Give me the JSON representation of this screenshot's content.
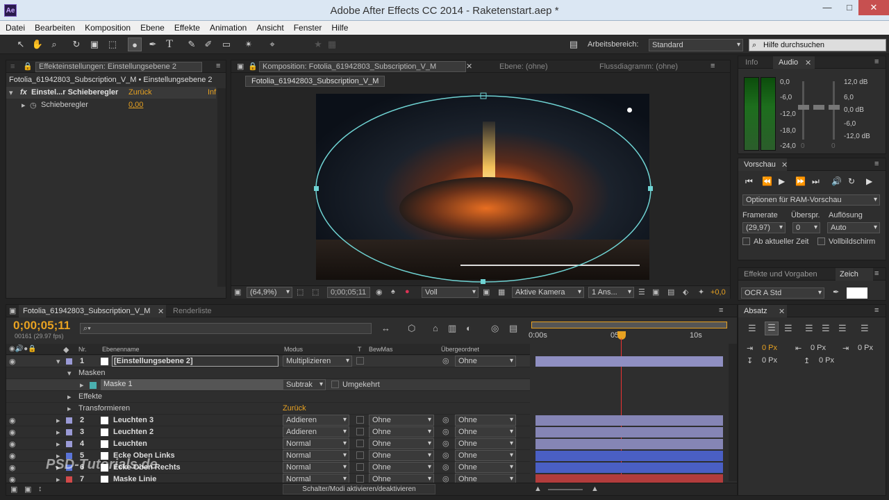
{
  "window": {
    "title": "Adobe After Effects CC 2014 - Raketenstart.aep *",
    "logo": "Ae",
    "min": "—",
    "max": "□",
    "close": "✕"
  },
  "menu": [
    "Datei",
    "Bearbeiten",
    "Komposition",
    "Ebene",
    "Effekte",
    "Animation",
    "Ansicht",
    "Fenster",
    "Hilfe"
  ],
  "toolbar": {
    "workspace_label": "Arbeitsbereich:",
    "workspace_value": "Standard",
    "help_placeholder": "Hilfe durchsuchen"
  },
  "effects_panel": {
    "tab": "Effekteinstellungen: Einstellungsebene 2",
    "breadcrumb": "Fotolia_61942803_Subscription_V_M • Einstellungsebene 2",
    "fx_label": "fx",
    "effect_name": "Einstel...r Schieberegler",
    "reset": "Zurück",
    "info": "Inf",
    "param_name": "Schieberegler",
    "param_value": "0,00"
  },
  "comp_panel": {
    "tab": "Komposition: Fotolia_61942803_Subscription_V_M",
    "tab_layer": "Ebene: (ohne)",
    "tab_flow": "Flussdiagramm: (ohne)",
    "subtab": "Fotolia_61942803_Subscription_V_M",
    "zoom": "(64,9%)",
    "timecode": "0;00;05;11",
    "resolution": "Voll",
    "camera": "Aktive Kamera",
    "views": "1 Ans...",
    "exposure": "+0,0"
  },
  "info_panel": {
    "tab_info": "Info",
    "tab_audio": "Audio",
    "left_db": [
      "0,0",
      "-6,0",
      "-12,0",
      "-18,0",
      "-24,0"
    ],
    "right_db": [
      "12,0 dB",
      "6,0",
      "0,0 dB",
      "-6,0",
      "-12,0 dB"
    ],
    "slider_zero_left": "0",
    "slider_zero_right": "0"
  },
  "preview_panel": {
    "tab": "Vorschau",
    "ram_options": "Optionen für RAM-Vorschau",
    "framerate_label": "Framerate",
    "skip_label": "Überspr.",
    "resolution_label": "Auflösung",
    "framerate_value": "(29,97)",
    "skip_value": "0",
    "resolution_value": "Auto",
    "from_current": "Ab aktueller Zeit",
    "fullscreen": "Vollbildschirm"
  },
  "effects_presets": {
    "tab": "Effekte und Vorgaben",
    "tab2": "Zeich",
    "font": "OCR A Std"
  },
  "paragraph_panel": {
    "tab": "Absatz",
    "values": [
      "0 Px",
      "0 Px",
      "0 Px",
      "0 Px",
      "0 Px"
    ]
  },
  "timeline": {
    "tab": "Fotolia_61942803_Subscription_V_M",
    "tab_render": "Renderliste",
    "timecode": "0;00;05;11",
    "frames": "00161 (29.97 fps)",
    "col_nr": "Nr.",
    "col_name": "Ebenenname",
    "col_mode": "Modus",
    "col_t": "T",
    "col_bewmas": "BewMas",
    "col_parent": "Übergeordnet",
    "ruler": [
      "0:00s",
      "05s",
      "10s"
    ],
    "footer": "Schalter/Modi aktivieren/deaktivieren",
    "masks_label": "Masken",
    "mask1": "Maske 1",
    "mask_mode": "Subtrak",
    "inverted": "Umgekehrt",
    "effects_label": "Effekte",
    "transform_label": "Transformieren",
    "transform_reset": "Zurück",
    "layers": [
      {
        "nr": "1",
        "name": "[Einstellungsebene 2]",
        "mode": "Multiplizieren",
        "bewmas": "",
        "parent": "Ohne",
        "color": "#9a9ad6",
        "bar": "#8f8fc2"
      },
      {
        "nr": "2",
        "name": "Leuchten 3",
        "mode": "Addieren",
        "bewmas": "Ohne",
        "parent": "Ohne",
        "color": "#9a9ad6",
        "bar": "#8585b5"
      },
      {
        "nr": "3",
        "name": "Leuchten 2",
        "mode": "Addieren",
        "bewmas": "Ohne",
        "parent": "Ohne",
        "color": "#9a9ad6",
        "bar": "#8585b5"
      },
      {
        "nr": "4",
        "name": "Leuchten",
        "mode": "Normal",
        "bewmas": "Ohne",
        "parent": "Ohne",
        "color": "#9a9ad6",
        "bar": "#8585b5"
      },
      {
        "nr": "5",
        "name": "Ecke Oben Links",
        "mode": "Normal",
        "bewmas": "Ohne",
        "parent": "Ohne",
        "color": "#5a74d8",
        "bar": "#4a5fc4"
      },
      {
        "nr": "6",
        "name": "Ecke Oben Rechts",
        "mode": "Normal",
        "bewmas": "Ohne",
        "parent": "Ohne",
        "color": "#5a74d8",
        "bar": "#4a5fc4"
      },
      {
        "nr": "7",
        "name": "Maske Linie",
        "mode": "Normal",
        "bewmas": "Ohne",
        "parent": "Ohne",
        "color": "#d24a4a",
        "bar": "#b23c3c"
      }
    ]
  },
  "watermark": "PSD-Tutorials.de"
}
